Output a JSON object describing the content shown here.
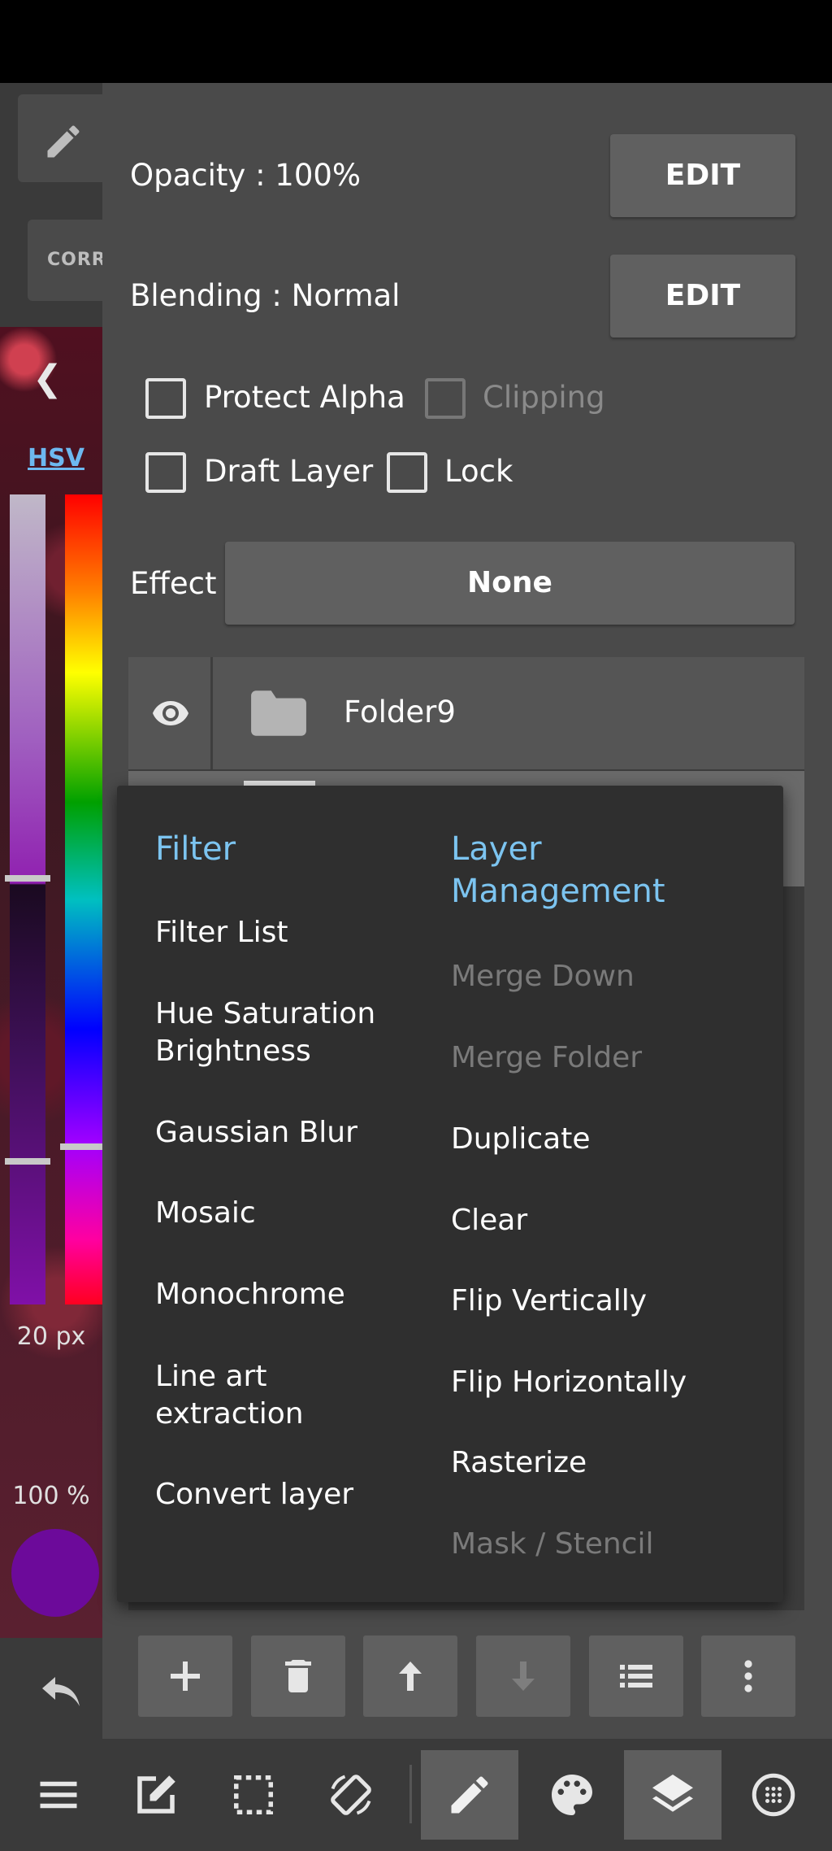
{
  "left_panel": {
    "correction_label": "CORR",
    "color_mode_label": "HSV",
    "brush_size": "20 px",
    "brush_opacity": "100 %",
    "current_color": "#6c0a9a",
    "icons": [
      "pen-icon",
      "chevron-left-icon",
      "undo-icon"
    ]
  },
  "layer_properties": {
    "opacity_label": "Opacity : 100%",
    "opacity_edit": "EDIT",
    "blending_label": "Blending : Normal",
    "blending_edit": "EDIT",
    "protect_alpha": "Protect Alpha",
    "clipping": "Clipping",
    "draft_layer": "Draft Layer",
    "lock": "Lock",
    "effect_label": "Effect",
    "effect_value": "None"
  },
  "layers": {
    "folder_name": "Folder9"
  },
  "menu": {
    "filter_heading": "Filter",
    "filter_items": [
      "Filter List",
      "Hue Saturation Brightness",
      "Gaussian Blur",
      "Mosaic",
      "Monochrome",
      "Line art extraction",
      "Convert layer"
    ],
    "layer_mgmt_heading": "Layer Management",
    "layer_mgmt_items": [
      "Merge Down",
      "Merge Folder",
      "Duplicate",
      "Clear",
      "Flip Vertically",
      "Flip Horizontally",
      "Rasterize",
      "Mask / Stencil"
    ]
  },
  "colors": {
    "accent": "#7cc4f0",
    "panel_bg": "#4a4a4a",
    "menu_bg": "#2f2f2f",
    "disabled_text": "#7a7a7a"
  },
  "toolbar_icons": [
    "add-icon",
    "trash-icon",
    "arrow-up-icon",
    "arrow-down-icon",
    "list-icon",
    "more-vertical-icon"
  ],
  "nav_icons": [
    "menu-icon",
    "edit-icon",
    "selection-icon",
    "rotate-icon",
    "pen-icon",
    "palette-icon",
    "layers-icon",
    "grid-icon"
  ]
}
